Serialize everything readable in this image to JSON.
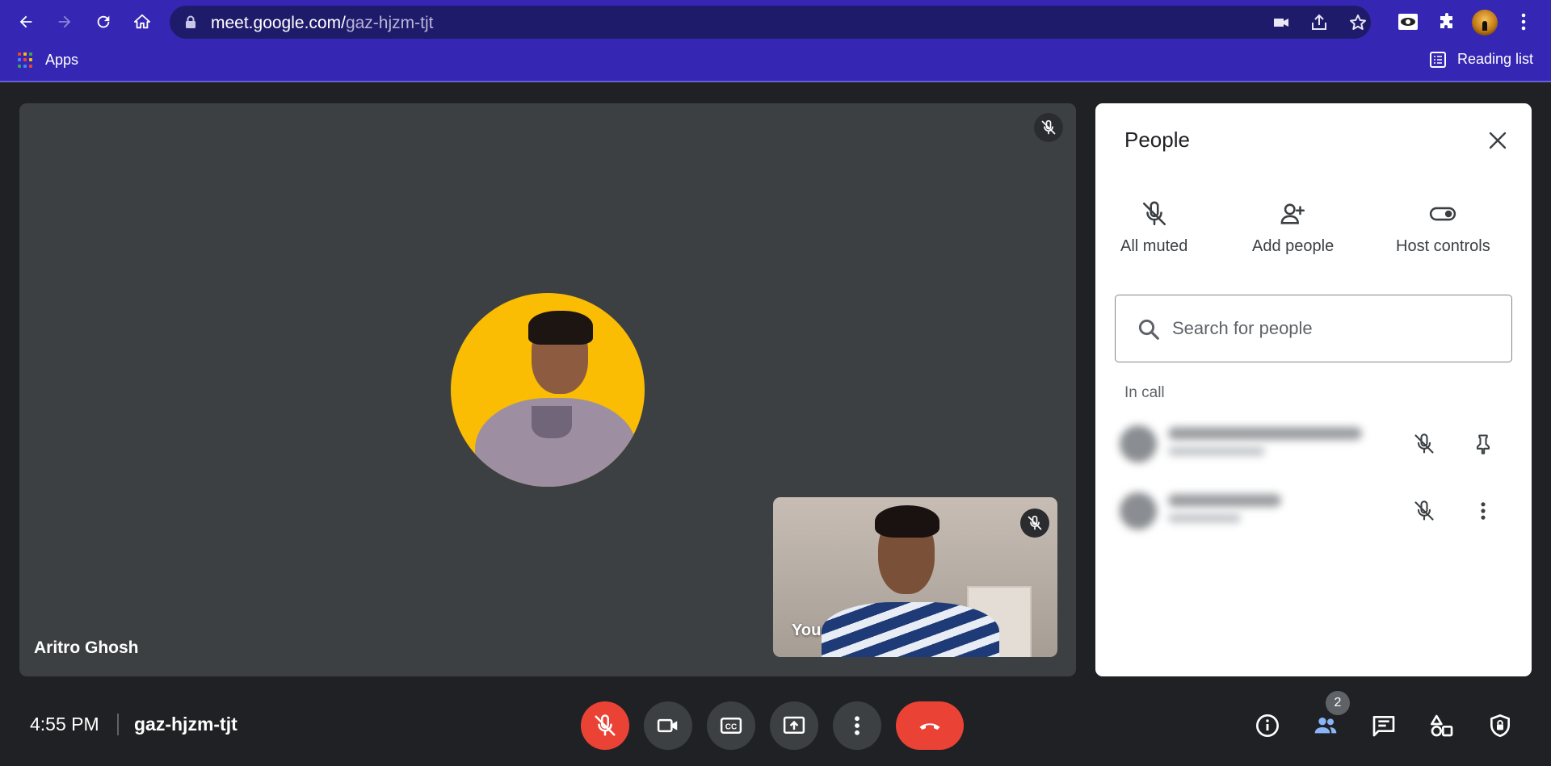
{
  "browser": {
    "url_host": "meet.google.com/",
    "url_path": "gaz-hjzm-tjt",
    "bookmarks": {
      "apps_label": "Apps",
      "reading_list_label": "Reading list"
    }
  },
  "stage": {
    "main_participant_name": "Aritro Ghosh",
    "self_label": "You"
  },
  "people_panel": {
    "title": "People",
    "actions": [
      {
        "label": "All muted",
        "icon": "mic-off-icon"
      },
      {
        "label": "Add people",
        "icon": "person-add-icon"
      },
      {
        "label": "Host controls",
        "icon": "toggle-icon"
      }
    ],
    "search_placeholder": "Search for people",
    "section_label": "In call"
  },
  "bottom_bar": {
    "time": "4:55 PM",
    "meeting_code": "gaz-hjzm-tjt",
    "participant_count": "2"
  },
  "colors": {
    "browser_chrome": "#3527b4",
    "omnibox": "#1f1b6b",
    "meet_background": "#202124",
    "tile": "#3c4043",
    "danger": "#ea4335",
    "avatar_bg": "#fbbc04",
    "active_blue": "#8ab4f8"
  }
}
